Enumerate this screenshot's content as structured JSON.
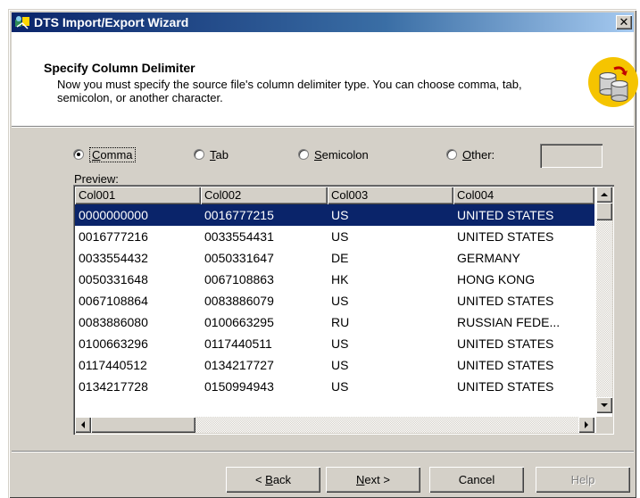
{
  "window": {
    "title": "DTS Import/Export Wizard",
    "close_glyph": "✕"
  },
  "header": {
    "title": "Specify Column Delimiter",
    "description": "Now you must specify the source file's column delimiter type.  You can choose comma, tab, semicolon, or another character.",
    "icon": "database-cylinders-icon"
  },
  "delimiter": {
    "selected": "comma",
    "options": [
      {
        "id": "comma",
        "label": "Comma",
        "accel": "C",
        "rest": "omma"
      },
      {
        "id": "tab",
        "label": "Tab",
        "accel": "T",
        "rest": "ab"
      },
      {
        "id": "semicolon",
        "label": "Semicolon",
        "accel": "S",
        "rest": "emicolon"
      },
      {
        "id": "other",
        "label": "Other:",
        "accel": "O",
        "rest": "ther:"
      }
    ],
    "other_value": ""
  },
  "preview": {
    "label": "Preview:",
    "columns": [
      "Col001",
      "Col002",
      "Col003",
      "Col004"
    ],
    "selected_row": 0,
    "rows": [
      [
        "0000000000",
        "0016777215",
        "US",
        "UNITED STATES"
      ],
      [
        "0016777216",
        "0033554431",
        "US",
        "UNITED STATES"
      ],
      [
        "0033554432",
        "0050331647",
        "DE",
        "GERMANY"
      ],
      [
        "0050331648",
        "0067108863",
        "HK",
        "HONG KONG"
      ],
      [
        "0067108864",
        "0083886079",
        "US",
        "UNITED STATES"
      ],
      [
        "0083886080",
        "0100663295",
        "RU",
        "RUSSIAN FEDE..."
      ],
      [
        "0100663296",
        "0117440511",
        "US",
        "UNITED STATES"
      ],
      [
        "0117440512",
        "0134217727",
        "US",
        "UNITED STATES"
      ],
      [
        "0134217728",
        "0150994943",
        "US",
        "UNITED STATES"
      ]
    ]
  },
  "buttons": {
    "back": {
      "label": "< Back",
      "pre": "< ",
      "accel": "B",
      "rest": "ack"
    },
    "next": {
      "label": "Next >",
      "pre": "",
      "accel": "N",
      "rest": "ext >"
    },
    "cancel": {
      "label": "Cancel"
    },
    "help": {
      "label": "Help"
    }
  },
  "colors": {
    "titlebar_start": "#0a246a",
    "titlebar_end": "#a6caf0",
    "selection": "#0a246a",
    "face": "#d4d0c8"
  }
}
